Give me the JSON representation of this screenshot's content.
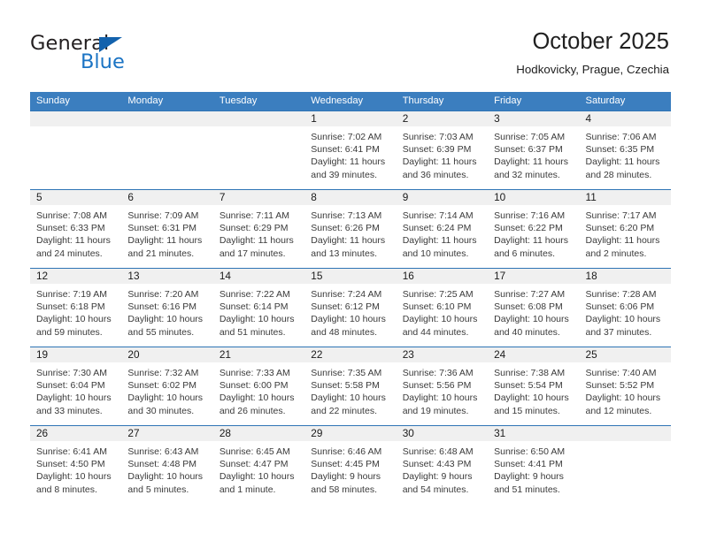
{
  "brand": {
    "name_dark": "General",
    "name_blue": "Blue",
    "triangle_color": "#1362ad",
    "blue_color": "#1b74c4"
  },
  "header": {
    "title": "October 2025",
    "subtitle": "Hodkovicky, Prague, Czechia"
  },
  "colors": {
    "header_blue": "#3b7ebf",
    "week_rule": "#2e74b5",
    "daynum_band": "#f0f0f0",
    "body_text": "#3a3a3a"
  },
  "weekdays": [
    "Sunday",
    "Monday",
    "Tuesday",
    "Wednesday",
    "Thursday",
    "Friday",
    "Saturday"
  ],
  "weeks": [
    [
      {
        "day": "",
        "lines": []
      },
      {
        "day": "",
        "lines": []
      },
      {
        "day": "",
        "lines": []
      },
      {
        "day": "1",
        "lines": [
          "Sunrise: 7:02 AM",
          "Sunset: 6:41 PM",
          "Daylight: 11 hours",
          "and 39 minutes."
        ]
      },
      {
        "day": "2",
        "lines": [
          "Sunrise: 7:03 AM",
          "Sunset: 6:39 PM",
          "Daylight: 11 hours",
          "and 36 minutes."
        ]
      },
      {
        "day": "3",
        "lines": [
          "Sunrise: 7:05 AM",
          "Sunset: 6:37 PM",
          "Daylight: 11 hours",
          "and 32 minutes."
        ]
      },
      {
        "day": "4",
        "lines": [
          "Sunrise: 7:06 AM",
          "Sunset: 6:35 PM",
          "Daylight: 11 hours",
          "and 28 minutes."
        ]
      }
    ],
    [
      {
        "day": "5",
        "lines": [
          "Sunrise: 7:08 AM",
          "Sunset: 6:33 PM",
          "Daylight: 11 hours",
          "and 24 minutes."
        ]
      },
      {
        "day": "6",
        "lines": [
          "Sunrise: 7:09 AM",
          "Sunset: 6:31 PM",
          "Daylight: 11 hours",
          "and 21 minutes."
        ]
      },
      {
        "day": "7",
        "lines": [
          "Sunrise: 7:11 AM",
          "Sunset: 6:29 PM",
          "Daylight: 11 hours",
          "and 17 minutes."
        ]
      },
      {
        "day": "8",
        "lines": [
          "Sunrise: 7:13 AM",
          "Sunset: 6:26 PM",
          "Daylight: 11 hours",
          "and 13 minutes."
        ]
      },
      {
        "day": "9",
        "lines": [
          "Sunrise: 7:14 AM",
          "Sunset: 6:24 PM",
          "Daylight: 11 hours",
          "and 10 minutes."
        ]
      },
      {
        "day": "10",
        "lines": [
          "Sunrise: 7:16 AM",
          "Sunset: 6:22 PM",
          "Daylight: 11 hours",
          "and 6 minutes."
        ]
      },
      {
        "day": "11",
        "lines": [
          "Sunrise: 7:17 AM",
          "Sunset: 6:20 PM",
          "Daylight: 11 hours",
          "and 2 minutes."
        ]
      }
    ],
    [
      {
        "day": "12",
        "lines": [
          "Sunrise: 7:19 AM",
          "Sunset: 6:18 PM",
          "Daylight: 10 hours",
          "and 59 minutes."
        ]
      },
      {
        "day": "13",
        "lines": [
          "Sunrise: 7:20 AM",
          "Sunset: 6:16 PM",
          "Daylight: 10 hours",
          "and 55 minutes."
        ]
      },
      {
        "day": "14",
        "lines": [
          "Sunrise: 7:22 AM",
          "Sunset: 6:14 PM",
          "Daylight: 10 hours",
          "and 51 minutes."
        ]
      },
      {
        "day": "15",
        "lines": [
          "Sunrise: 7:24 AM",
          "Sunset: 6:12 PM",
          "Daylight: 10 hours",
          "and 48 minutes."
        ]
      },
      {
        "day": "16",
        "lines": [
          "Sunrise: 7:25 AM",
          "Sunset: 6:10 PM",
          "Daylight: 10 hours",
          "and 44 minutes."
        ]
      },
      {
        "day": "17",
        "lines": [
          "Sunrise: 7:27 AM",
          "Sunset: 6:08 PM",
          "Daylight: 10 hours",
          "and 40 minutes."
        ]
      },
      {
        "day": "18",
        "lines": [
          "Sunrise: 7:28 AM",
          "Sunset: 6:06 PM",
          "Daylight: 10 hours",
          "and 37 minutes."
        ]
      }
    ],
    [
      {
        "day": "19",
        "lines": [
          "Sunrise: 7:30 AM",
          "Sunset: 6:04 PM",
          "Daylight: 10 hours",
          "and 33 minutes."
        ]
      },
      {
        "day": "20",
        "lines": [
          "Sunrise: 7:32 AM",
          "Sunset: 6:02 PM",
          "Daylight: 10 hours",
          "and 30 minutes."
        ]
      },
      {
        "day": "21",
        "lines": [
          "Sunrise: 7:33 AM",
          "Sunset: 6:00 PM",
          "Daylight: 10 hours",
          "and 26 minutes."
        ]
      },
      {
        "day": "22",
        "lines": [
          "Sunrise: 7:35 AM",
          "Sunset: 5:58 PM",
          "Daylight: 10 hours",
          "and 22 minutes."
        ]
      },
      {
        "day": "23",
        "lines": [
          "Sunrise: 7:36 AM",
          "Sunset: 5:56 PM",
          "Daylight: 10 hours",
          "and 19 minutes."
        ]
      },
      {
        "day": "24",
        "lines": [
          "Sunrise: 7:38 AM",
          "Sunset: 5:54 PM",
          "Daylight: 10 hours",
          "and 15 minutes."
        ]
      },
      {
        "day": "25",
        "lines": [
          "Sunrise: 7:40 AM",
          "Sunset: 5:52 PM",
          "Daylight: 10 hours",
          "and 12 minutes."
        ]
      }
    ],
    [
      {
        "day": "26",
        "lines": [
          "Sunrise: 6:41 AM",
          "Sunset: 4:50 PM",
          "Daylight: 10 hours",
          "and 8 minutes."
        ]
      },
      {
        "day": "27",
        "lines": [
          "Sunrise: 6:43 AM",
          "Sunset: 4:48 PM",
          "Daylight: 10 hours",
          "and 5 minutes."
        ]
      },
      {
        "day": "28",
        "lines": [
          "Sunrise: 6:45 AM",
          "Sunset: 4:47 PM",
          "Daylight: 10 hours",
          "and 1 minute."
        ]
      },
      {
        "day": "29",
        "lines": [
          "Sunrise: 6:46 AM",
          "Sunset: 4:45 PM",
          "Daylight: 9 hours",
          "and 58 minutes."
        ]
      },
      {
        "day": "30",
        "lines": [
          "Sunrise: 6:48 AM",
          "Sunset: 4:43 PM",
          "Daylight: 9 hours",
          "and 54 minutes."
        ]
      },
      {
        "day": "31",
        "lines": [
          "Sunrise: 6:50 AM",
          "Sunset: 4:41 PM",
          "Daylight: 9 hours",
          "and 51 minutes."
        ]
      },
      {
        "day": "",
        "lines": []
      }
    ]
  ]
}
